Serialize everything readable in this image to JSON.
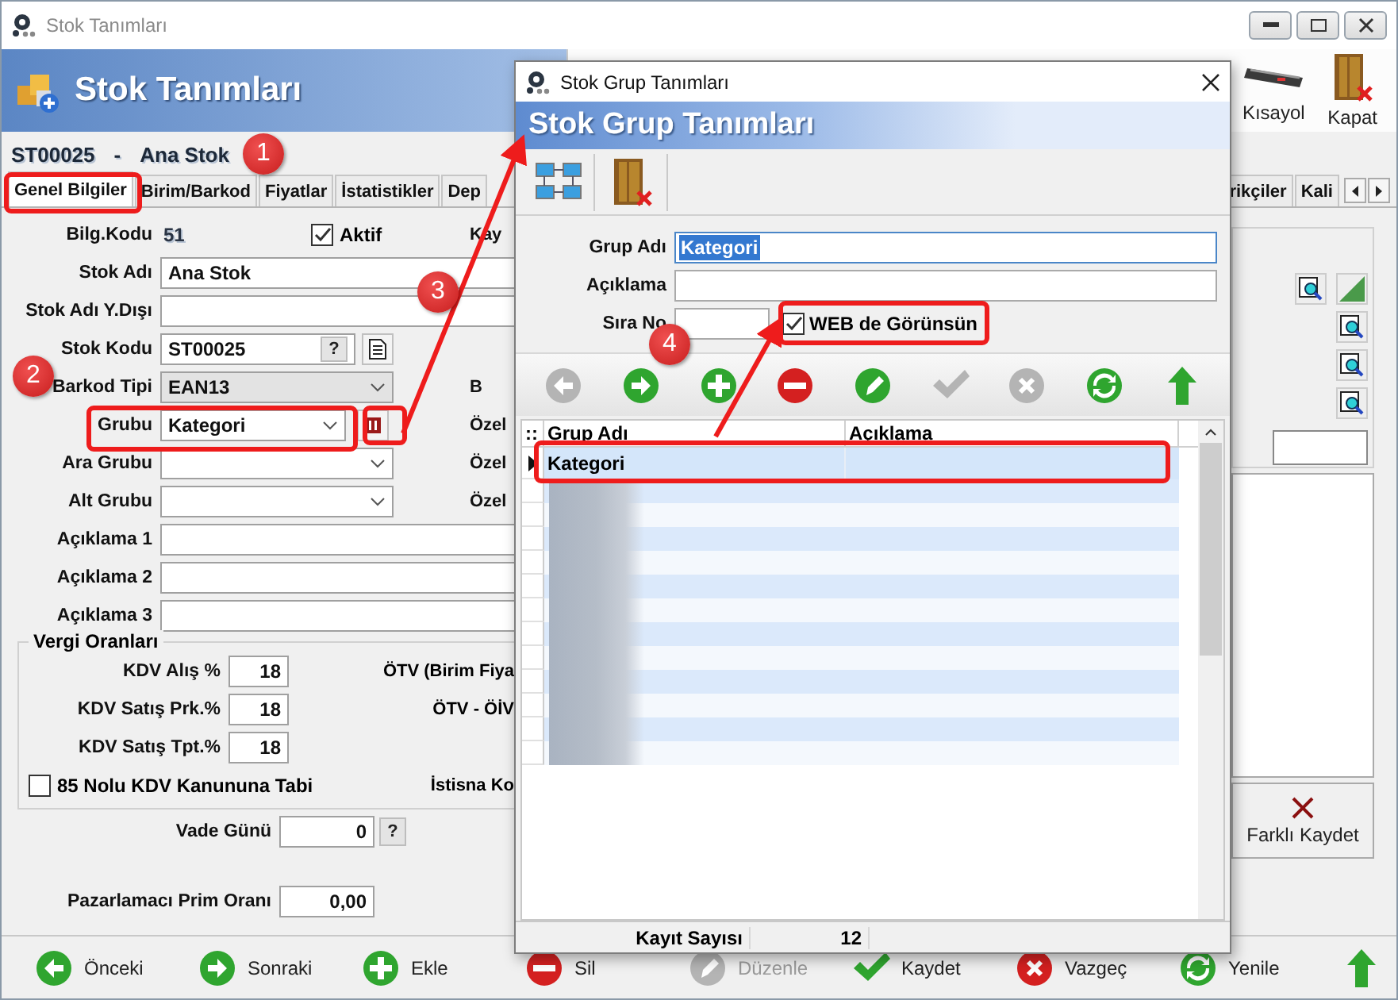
{
  "window": {
    "title": "Stok Tanımları"
  },
  "header": {
    "title": "Stok Tanımları"
  },
  "toolbar": [
    {
      "label": "Kısayol",
      "kind": "keyboard"
    },
    {
      "label": "Kapat",
      "kind": "exit"
    }
  ],
  "record": {
    "code": "ST00025",
    "separator": "-",
    "name": "Ana Stok"
  },
  "tabs": [
    {
      "label": "Genel Bilgiler",
      "selected": true
    },
    {
      "label": "Birim/Barkod",
      "selected": false
    },
    {
      "label": "Fiyatlar",
      "selected": false
    },
    {
      "label": "İstatistikler",
      "selected": false
    },
    {
      "label": "Dep",
      "selected": false
    }
  ],
  "tabs_right": [
    "rikçiler",
    "Kali"
  ],
  "general": {
    "bilg_kodu": {
      "label": "Bilg.Kodu",
      "value": "51"
    },
    "aktif": {
      "label": "Aktif",
      "checked": true
    },
    "bilg_side_label": "Kay",
    "fields": [
      {
        "kind": "text",
        "label": "Stok Adı",
        "value": "Ana Stok"
      },
      {
        "kind": "text",
        "label": "Stok Adı Y.Dışı"
      },
      {
        "kind": "code",
        "label": "Stok Kodu",
        "value": "ST00025",
        "button": "?"
      },
      {
        "kind": "combo",
        "label": "Barkod Tipi",
        "value": "EAN13",
        "disabled": true,
        "lookup": false,
        "side_label": "B"
      },
      {
        "kind": "combo",
        "label": "Grubu",
        "value": "Kategori",
        "disabled": false,
        "lookup": true,
        "side_label": "Özel"
      },
      {
        "kind": "combo",
        "label": "Ara Grubu",
        "disabled": false,
        "lookup": false,
        "side_label": "Özel"
      },
      {
        "kind": "combo",
        "label": "Alt Grubu",
        "disabled": false,
        "lookup": false,
        "side_label": "Özel"
      },
      {
        "kind": "text",
        "label": "Açıklama 1"
      },
      {
        "kind": "text",
        "label": "Açıklama 2"
      },
      {
        "kind": "text",
        "label": "Açıklama 3"
      }
    ],
    "tax": {
      "title": "Vergi Oranları",
      "rates": [
        {
          "label": "KDV Alış %",
          "value": "18",
          "side_label": "ÖTV (Birim Fiya"
        },
        {
          "label": "KDV Satış Prk.%",
          "value": "18",
          "side_label": "ÖTV - ÖİV"
        },
        {
          "label": "KDV Satış Tpt.%",
          "value": "18"
        }
      ],
      "kdv85": {
        "label": "85 Nolu KDV Kanununa Tabi",
        "checked": false,
        "side_label": "İstisna Ko"
      }
    },
    "vade": {
      "label": "Vade Günü",
      "value": "0",
      "button": "?"
    },
    "prim": {
      "label": "Pazarlamacı Prim Oranı",
      "value": "0,00"
    }
  },
  "right_panel": {
    "button": "Farklı Kaydet"
  },
  "bottom_bar": [
    {
      "kind": "prev",
      "label": "Önceki",
      "disabled": false
    },
    {
      "kind": "next",
      "label": "Sonraki",
      "disabled": false
    },
    {
      "kind": "add",
      "label": "Ekle",
      "disabled": false
    },
    {
      "kind": "delete",
      "label": "Sil",
      "disabled": false
    },
    {
      "kind": "edit",
      "label": "Düzenle",
      "disabled": true
    },
    {
      "kind": "save",
      "label": "Kaydet",
      "disabled": false
    },
    {
      "kind": "cancel",
      "label": "Vazgeç",
      "disabled": false
    },
    {
      "kind": "refresh",
      "label": "Yenile",
      "disabled": false
    },
    {
      "kind": "up",
      "disabled": false
    }
  ],
  "dialog": {
    "title": "Stok Grup Tanımları",
    "header": "Stok Grup Tanımları",
    "tools": [
      {
        "kind": "network"
      },
      {
        "kind": "exit"
      }
    ],
    "fields": [
      {
        "label": "Grup Adı",
        "value": "Kategori",
        "text_selected": true
      },
      {
        "label": "Açıklama",
        "text_selected": false
      }
    ],
    "sira_no": {
      "label": "Sıra No"
    },
    "web": {
      "label": "WEB de Görünsün",
      "checked": true
    },
    "nav": [
      {
        "kind": "prev",
        "disabled": true
      },
      {
        "kind": "next",
        "disabled": false
      },
      {
        "kind": "add",
        "disabled": false
      },
      {
        "kind": "delete",
        "disabled": false
      },
      {
        "kind": "edit",
        "disabled": false
      },
      {
        "kind": "save",
        "disabled": true
      },
      {
        "kind": "cancel",
        "disabled": true
      },
      {
        "kind": "refresh",
        "disabled": false
      },
      {
        "kind": "up",
        "disabled": false
      }
    ],
    "grid": {
      "columns": [
        "::",
        "Grup Adı",
        "Açıklama"
      ],
      "rows": [
        {
          "kind": "text",
          "grup_adi": "Kategori",
          "selected": true
        },
        {
          "kind": "blurred",
          "selected": false
        },
        {
          "kind": "blurred",
          "selected": false
        },
        {
          "kind": "blurred",
          "selected": false
        },
        {
          "kind": "blurred",
          "selected": false
        },
        {
          "kind": "blurred",
          "selected": false
        },
        {
          "kind": "blurred",
          "selected": false
        },
        {
          "kind": "blurred",
          "selected": false
        },
        {
          "kind": "blurred",
          "selected": false
        },
        {
          "kind": "blurred",
          "selected": false
        },
        {
          "kind": "blurred",
          "selected": false
        },
        {
          "kind": "blurred",
          "selected": false
        },
        {
          "kind": "blurred",
          "selected": false
        }
      ]
    },
    "footer": {
      "label": "Kayıt Sayısı",
      "value": "12"
    }
  },
  "annotations": [
    "1",
    "2",
    "3",
    "4"
  ]
}
